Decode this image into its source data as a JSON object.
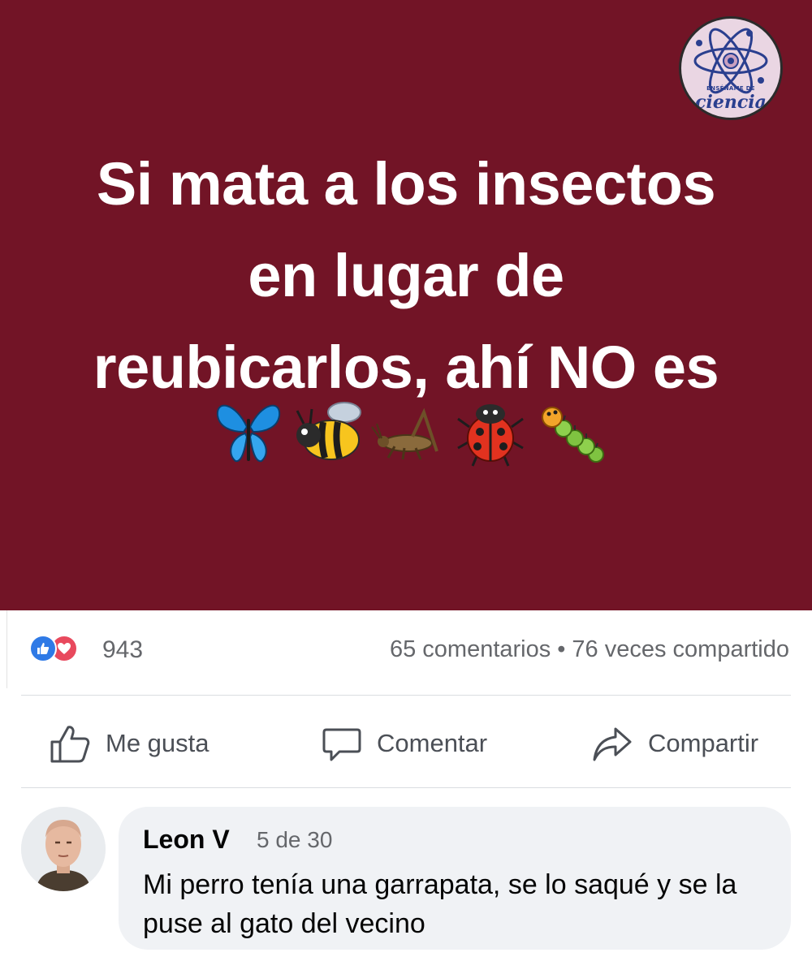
{
  "post": {
    "headline_lines": [
      "Si mata a los insectos",
      "en lugar de",
      "reubicarlos, ahí NO es"
    ],
    "emojis": [
      {
        "icon": "butterfly-icon",
        "glyph": "🦋"
      },
      {
        "icon": "bee-icon",
        "glyph": "🐝"
      },
      {
        "icon": "cricket-icon",
        "glyph": "🦗"
      },
      {
        "icon": "ladybug-icon",
        "glyph": "🐞"
      },
      {
        "icon": "caterpillar-icon",
        "glyph": "🐛"
      }
    ],
    "logo": {
      "small_text": "ENSÉÑAME DE",
      "script_text": "ciencia"
    },
    "colors": {
      "background": "#721426",
      "text": "#ffffff"
    }
  },
  "reactions": {
    "icons": [
      "like-reaction-icon",
      "love-reaction-icon"
    ],
    "count": "943",
    "comments": "65 comentarios",
    "separator": "•",
    "shares": "76 veces compartido"
  },
  "actions": {
    "like_label": "Me gusta",
    "comment_label": "Comentar",
    "share_label": "Compartir"
  },
  "comment": {
    "author": "Leon V",
    "date": "5 de 30",
    "text": "Mi perro tenía una garrapata,  se lo saqué y se la puse al gato del vecino"
  }
}
